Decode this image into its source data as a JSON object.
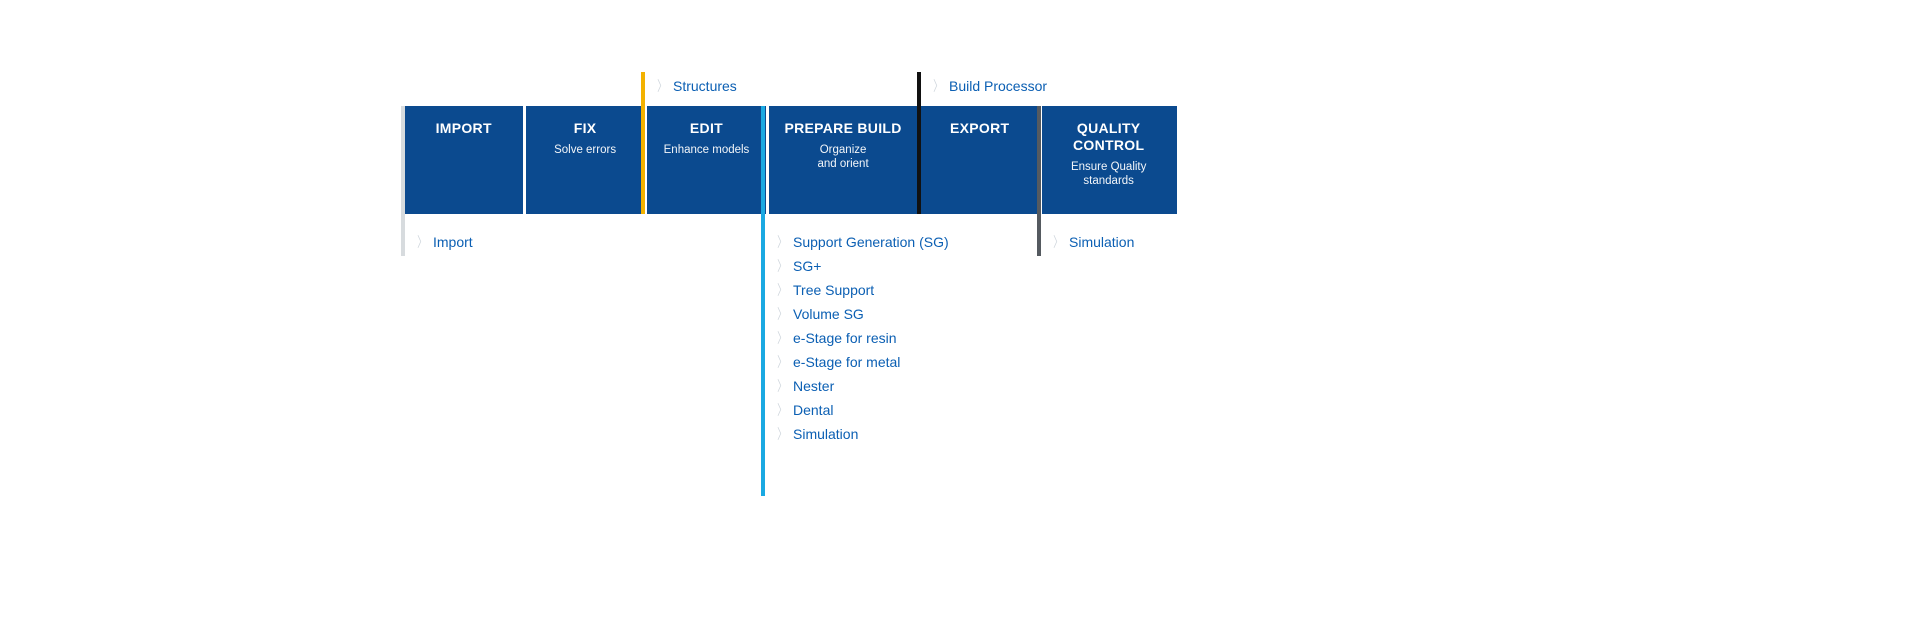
{
  "stages": [
    {
      "title": "IMPORT",
      "sub": ""
    },
    {
      "title": "FIX",
      "sub": "Solve errors"
    },
    {
      "title": "EDIT",
      "sub": "Enhance models"
    },
    {
      "title": "PREPARE BUILD",
      "sub": "Organize\nand orient"
    },
    {
      "title": "EXPORT",
      "sub": ""
    },
    {
      "title": "QUALITY CONTROL",
      "sub": "Ensure Quality standards"
    }
  ],
  "colors": {
    "grey": "#d7dbde",
    "yellow": "#f3b200",
    "cyan": "#1aa9e2",
    "black": "#111111",
    "dark": "#555a60"
  },
  "topLabels": {
    "edit": "Structures",
    "export": "Build Processor"
  },
  "bottom": {
    "import": [
      "Import"
    ],
    "prepare": [
      "Support Generation (SG)",
      "SG+",
      "Tree Support",
      "Volume SG",
      "e-Stage for resin",
      "e-Stage for metal",
      "Nester",
      "Dental",
      "Simulation"
    ],
    "quality": [
      "Simulation"
    ]
  }
}
